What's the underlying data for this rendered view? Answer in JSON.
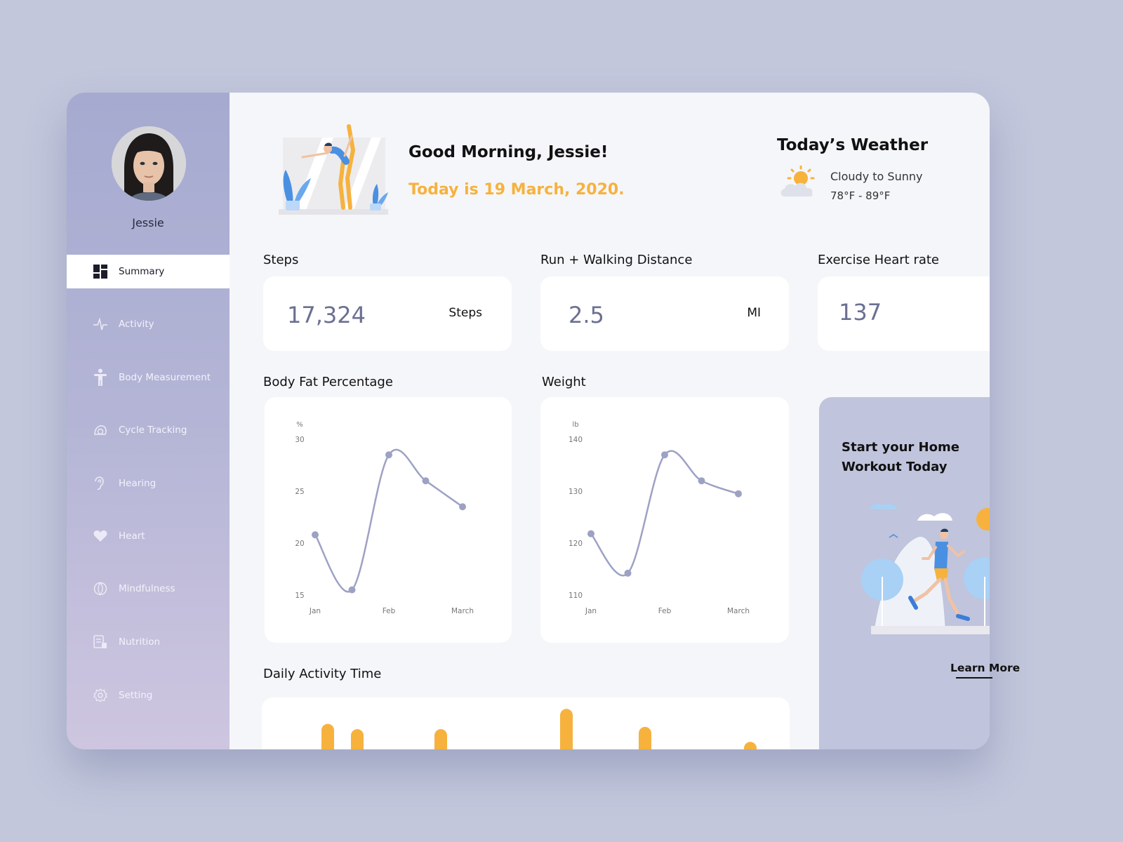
{
  "user": {
    "name": "Jessie"
  },
  "sidebar": {
    "items": [
      {
        "label": "Summary",
        "icon": "summary-grid-icon",
        "active": true
      },
      {
        "label": "Activity",
        "icon": "activity-pulse-icon"
      },
      {
        "label": "Body Measurement",
        "icon": "body-figure-icon"
      },
      {
        "label": "Cycle Tracking",
        "icon": "cycle-tracking-icon"
      },
      {
        "label": "Hearing",
        "icon": "ear-icon"
      },
      {
        "label": "Heart",
        "icon": "heart-icon"
      },
      {
        "label": "Mindfulness",
        "icon": "mindfulness-icon"
      },
      {
        "label": "Nutrition",
        "icon": "nutrition-icon"
      },
      {
        "label": "Setting",
        "icon": "gear-icon"
      }
    ]
  },
  "header": {
    "greeting": "Good Morning, Jessie!",
    "date_text": "Today is 19 March, 2020."
  },
  "weather": {
    "title": "Today’s Weather",
    "condition": "Cloudy to Sunny",
    "temperature": "78°F - 89°F",
    "icon": "sun-cloud-icon"
  },
  "metrics": {
    "steps": {
      "label": "Steps",
      "value": "17,324",
      "unit": "Steps"
    },
    "distance": {
      "label": "Run + Walking Distance",
      "value": "2.5",
      "unit": "MI"
    },
    "heart_rate": {
      "label": "Exercise Heart rate",
      "value": "137"
    }
  },
  "chart_data": [
    {
      "type": "line",
      "title": "Body Fat Percentage",
      "ylabel": "%",
      "x_ticks": [
        "Jan",
        "Feb",
        "March"
      ],
      "y_ticks": [
        15,
        20,
        25,
        30
      ],
      "ylim": [
        15,
        30
      ],
      "x": [
        0,
        0.5,
        1.0,
        1.5,
        2.0
      ],
      "values": [
        20.8,
        15.5,
        28.5,
        26.0,
        23.5
      ]
    },
    {
      "type": "line",
      "title": "Weight",
      "ylabel": "lb",
      "x_ticks": [
        "Jan",
        "Feb",
        "March"
      ],
      "y_ticks": [
        110,
        120,
        130,
        140
      ],
      "ylim": [
        110,
        140
      ],
      "x": [
        0,
        0.5,
        1.0,
        1.5,
        2.0
      ],
      "values": [
        121.8,
        114.2,
        137.0,
        132.0,
        129.5
      ]
    },
    {
      "type": "bar",
      "title": "Daily Activity Time",
      "values": [
        34,
        27,
        27,
        54,
        30,
        10
      ],
      "visible_range": [
        0,
        58
      ]
    }
  ],
  "promo": {
    "text": "Start  your Home Workout Today",
    "link": "Learn More"
  },
  "colors": {
    "accent": "#f6b23d",
    "line": "#9da2c4",
    "sidebar_top": "#a6aad0",
    "sidebar_bottom": "#cec6e0",
    "promo_bg": "#c0c4dc"
  }
}
